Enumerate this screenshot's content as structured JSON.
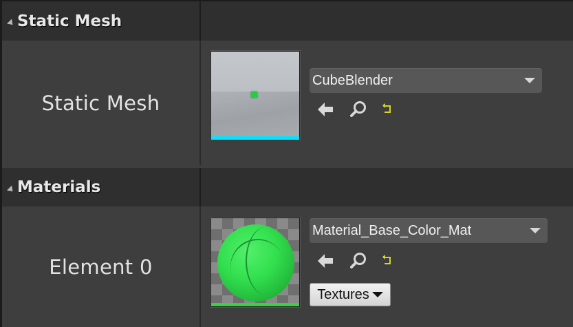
{
  "categories": {
    "static_mesh": {
      "title": "Static Mesh"
    },
    "materials": {
      "title": "Materials"
    }
  },
  "properties": {
    "static_mesh": {
      "label": "Static Mesh",
      "asset_name": "CubeBlender",
      "thumbnail_accent": "#00e5ff"
    },
    "element0": {
      "label": "Element 0",
      "asset_name": "Material_Base_Color_Mat",
      "thumbnail_accent": "#3ccf4a",
      "textures_button": "Textures"
    }
  },
  "icons": {
    "use_selected": "arrow-left-icon",
    "browse": "magnifier-icon",
    "reset": "reset-to-default-icon"
  },
  "colors": {
    "panel_bg": "#3e3e3e",
    "header_bg": "#2f2f2f",
    "reset_icon": "#d4d42a"
  }
}
